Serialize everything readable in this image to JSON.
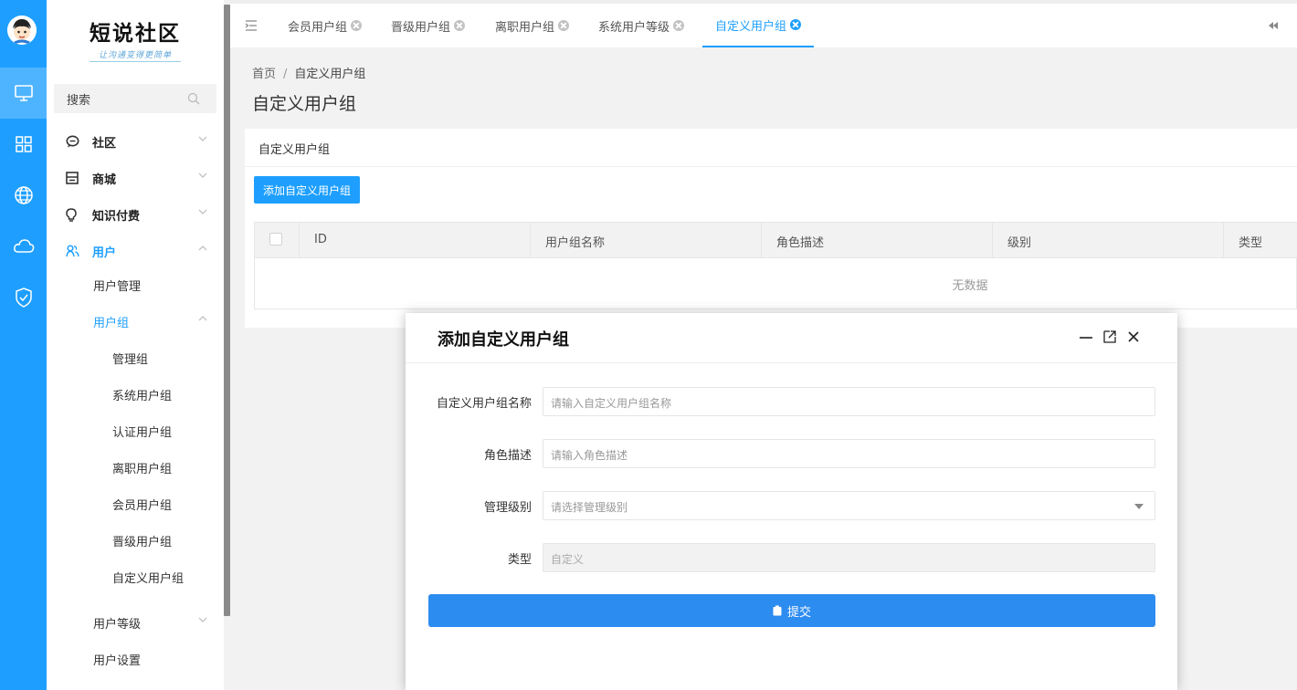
{
  "logo": {
    "title": "短说社区",
    "subtitle": "让沟通变得更简单"
  },
  "search": {
    "placeholder": "搜索"
  },
  "nav": {
    "community": "社区",
    "mall": "商城",
    "knowledge": "知识付费",
    "user": "用户",
    "user_manage": "用户管理",
    "user_group": "用户组",
    "groups": [
      "管理组",
      "系统用户组",
      "认证用户组",
      "离职用户组",
      "会员用户组",
      "晋级用户组",
      "自定义用户组"
    ],
    "user_level": "用户等级",
    "user_settings": "用户设置"
  },
  "tabs": [
    {
      "label": "会员用户组"
    },
    {
      "label": "晋级用户组"
    },
    {
      "label": "离职用户组"
    },
    {
      "label": "系统用户等级"
    },
    {
      "label": "自定义用户组"
    }
  ],
  "breadcrumb": {
    "home": "首页",
    "sep": "/",
    "current": "自定义用户组"
  },
  "page_title": "自定义用户组",
  "card": {
    "title": "自定义用户组",
    "add_button": "添加自定义用户组",
    "columns": [
      "ID",
      "用户组名称",
      "角色描述",
      "级别",
      "类型"
    ],
    "empty_text": "无数据"
  },
  "modal": {
    "title": "添加自定义用户组",
    "fields": {
      "name_label": "自定义用户组名称",
      "name_placeholder": "请输入自定义用户组名称",
      "desc_label": "角色描述",
      "desc_placeholder": "请输入角色描述",
      "level_label": "管理级别",
      "level_placeholder": "请选择管理级别",
      "type_label": "类型",
      "type_value": "自定义"
    },
    "submit_label": "提交"
  },
  "colors": {
    "accent": "#1e9fff",
    "submit": "#2d8cf0"
  }
}
